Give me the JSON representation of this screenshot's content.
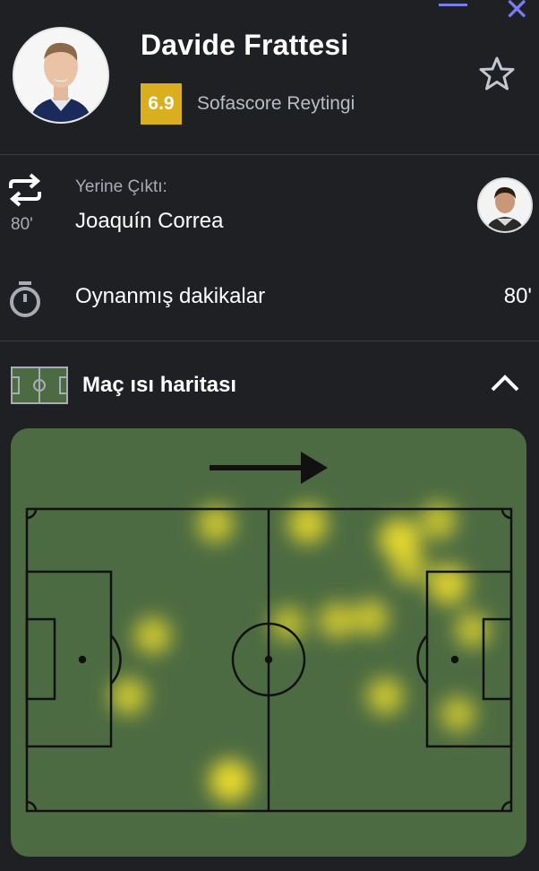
{
  "window": {
    "minimize_icon": "minimize-icon",
    "close_icon": "close-icon"
  },
  "player": {
    "name": "Davide Frattesi",
    "rating": "6.9",
    "rating_label": "Sofascore Reytingi",
    "rating_color": "#d9af1f",
    "favorite_icon": "star-icon"
  },
  "substitution": {
    "icon": "substitution-icon",
    "minute": "80'",
    "label": "Yerine Çıktı:",
    "replaced_by": "Joaquín Correa"
  },
  "minutes_played": {
    "icon": "stopwatch-icon",
    "label": "Oynanmış dakikalar",
    "value": "80'"
  },
  "heatmap": {
    "title": "Maç ısı haritası",
    "icon": "pitch-icon",
    "toggle_icon": "chevron-up-icon",
    "direction_icon": "attack-direction-arrow-icon",
    "pitch_color": "#4c6b42",
    "heat_color": "#f2e12d",
    "spots": [
      {
        "x": 39,
        "y": 5,
        "intensity": 0.6
      },
      {
        "x": 58,
        "y": 5,
        "intensity": 0.75
      },
      {
        "x": 77,
        "y": 10,
        "intensity": 0.9
      },
      {
        "x": 85,
        "y": 4,
        "intensity": 0.55
      },
      {
        "x": 79,
        "y": 19,
        "intensity": 0.5
      },
      {
        "x": 87,
        "y": 25,
        "intensity": 0.8
      },
      {
        "x": 92,
        "y": 40,
        "intensity": 0.5
      },
      {
        "x": 71,
        "y": 36,
        "intensity": 0.55
      },
      {
        "x": 64,
        "y": 37,
        "intensity": 0.55
      },
      {
        "x": 54,
        "y": 38,
        "intensity": 0.45
      },
      {
        "x": 26,
        "y": 42,
        "intensity": 0.6
      },
      {
        "x": 21,
        "y": 62,
        "intensity": 0.6
      },
      {
        "x": 74,
        "y": 62,
        "intensity": 0.6
      },
      {
        "x": 89,
        "y": 68,
        "intensity": 0.5
      },
      {
        "x": 42,
        "y": 90,
        "intensity": 0.95
      }
    ]
  }
}
